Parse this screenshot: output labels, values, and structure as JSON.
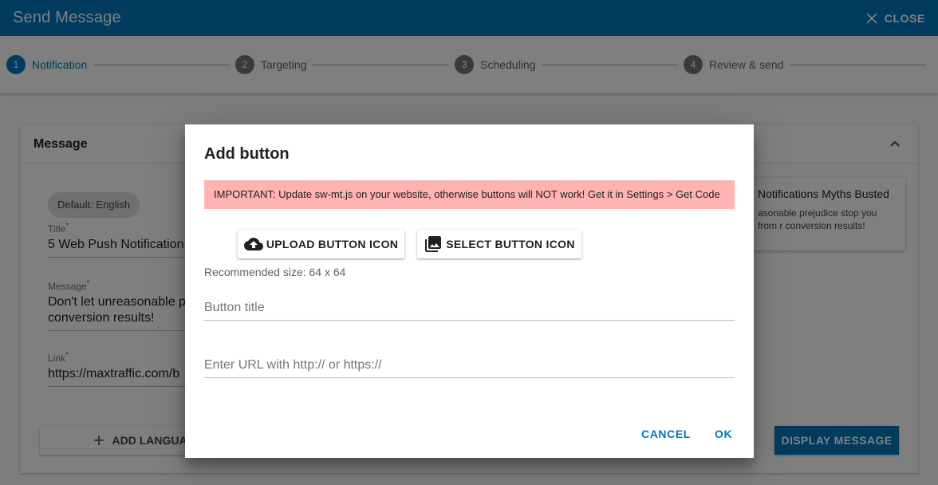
{
  "appbar": {
    "title": "Send Message",
    "close_label": "CLOSE"
  },
  "stepper": {
    "steps": [
      {
        "number": "1",
        "label": "Notification"
      },
      {
        "number": "2",
        "label": "Targeting"
      },
      {
        "number": "3",
        "label": "Scheduling"
      },
      {
        "number": "4",
        "label": "Review & send"
      }
    ]
  },
  "card": {
    "title": "Message",
    "language_chip": "Default: English",
    "title_label": "Title",
    "title_value": "5 Web Push Notification",
    "message_label": "Message",
    "message_value_line1": "Don't let unreasonable p",
    "message_value_line2": "conversion results!",
    "link_label": "Link",
    "link_value": "https://maxtraffic.com/b",
    "required_mark": "*",
    "add_language_label": "ADD LANGUAG",
    "display_message_label": "DISPLAY MESSAGE",
    "preview_title": "Notifications Myths Busted",
    "preview_text": "asonable prejudice stop you from r conversion results!"
  },
  "dialog": {
    "title": "Add button",
    "alert": "IMPORTANT: Update sw-mt.js on your website, otherwise buttons will NOT work! Get it in Settings > Get Code",
    "upload_label": "UPLOAD BUTTON ICON",
    "select_label": "SELECT BUTTON ICON",
    "recommended_size": "Recommended size: 64 x 64",
    "button_title_placeholder": "Button title",
    "url_placeholder": "Enter URL with http:// or https://",
    "cancel_label": "CANCEL",
    "ok_label": "OK"
  },
  "colors": {
    "primary": "#0277bd",
    "alert_bg": "#ffb3b3"
  }
}
